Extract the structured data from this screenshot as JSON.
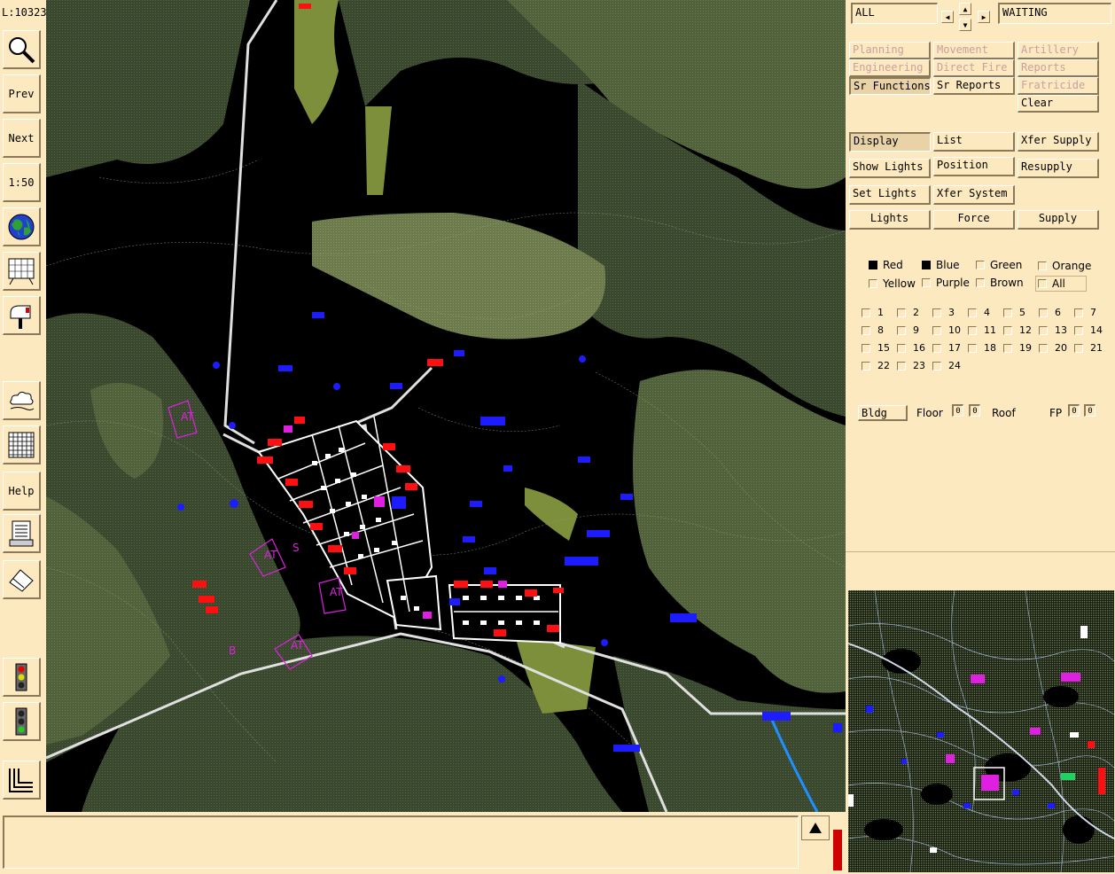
{
  "toolbar": {
    "coord": "L:10323",
    "prev": "Prev",
    "next": "Next",
    "scale": "1:50",
    "help": "Help"
  },
  "header": {
    "filter": "ALL",
    "status": "WAITING"
  },
  "functions": {
    "planning": "Planning",
    "movement": "Movement",
    "artillery": "Artillery",
    "engineering": "Engineering",
    "direct_fire": "Direct Fire",
    "reports": "Reports",
    "sr_functions": "Sr Functions",
    "sr_reports": "Sr Reports",
    "fratricide": "Fratricide",
    "clear": "Clear"
  },
  "actions": {
    "display": "Display",
    "list": "List",
    "xfer_supply": "Xfer Supply",
    "show_lights": "Show Lights",
    "position": "Position",
    "resupply": "Resupply",
    "set_lights": "Set Lights",
    "xfer_system": "Xfer System",
    "lights": "Lights",
    "force": "Force",
    "supply": "Supply"
  },
  "colors": {
    "red": "Red",
    "blue": "Blue",
    "green": "Green",
    "orange": "Orange",
    "yellow": "Yellow",
    "purple": "Purple",
    "brown": "Brown",
    "all": "All"
  },
  "numbers": [
    "1",
    "2",
    "3",
    "4",
    "5",
    "6",
    "7",
    "8",
    "9",
    "10",
    "11",
    "12",
    "13",
    "14",
    "15",
    "16",
    "17",
    "18",
    "19",
    "20",
    "21",
    "22",
    "23",
    "24"
  ],
  "building": {
    "bldg": "Bldg",
    "floor_label": "Floor",
    "floor_a": "0",
    "floor_b": "0",
    "roof_label": "Roof",
    "fp_label": "FP",
    "fp_a": "0",
    "fp_b": "0"
  },
  "palette": {
    "panel_bg": "#fde9bf",
    "terrain_dark": "#3a4a30",
    "terrain_mid": "#556b3f",
    "terrain_light": "#7a8a55",
    "blue_force": "#1c1cff",
    "red_force": "#ff1010",
    "magenta": "#e020e0"
  },
  "map_labels": {
    "at1": "AT",
    "at2": "AT",
    "at3": "AT",
    "at4": "AT",
    "s": "S",
    "b": "B"
  },
  "message": {
    "text": "",
    "scroll_up_icon": "triangle-up-icon"
  }
}
